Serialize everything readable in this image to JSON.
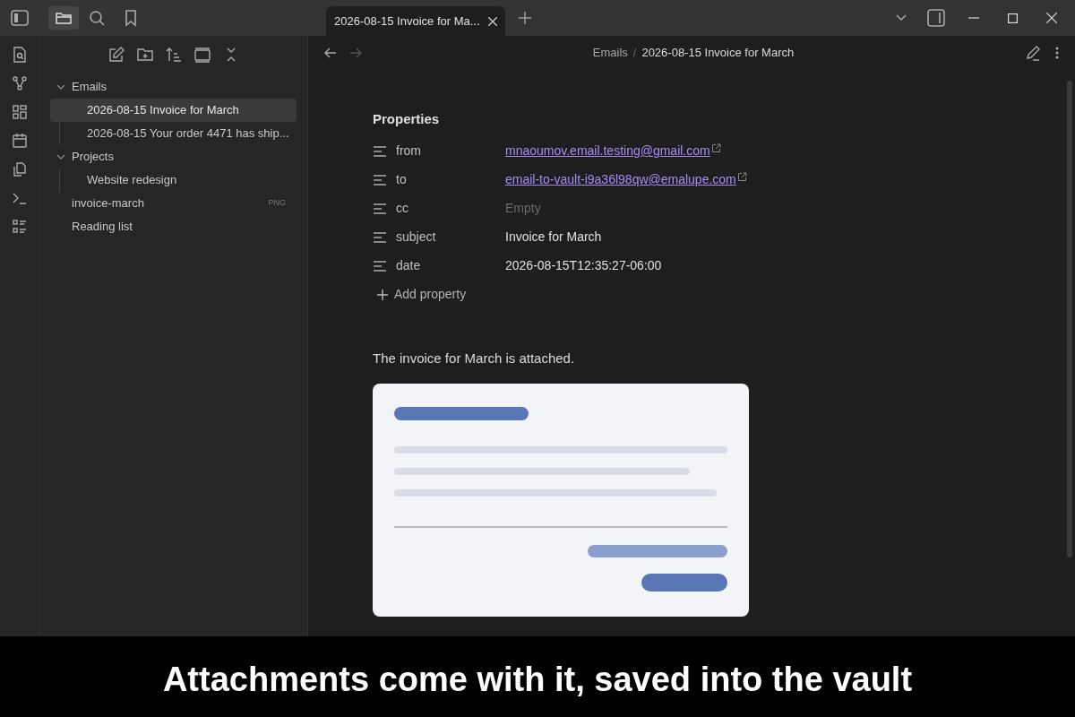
{
  "tabs": [
    {
      "label": "2026-08-15 Invoice for Ma...",
      "selected": true
    }
  ],
  "file_tree": [
    {
      "label": "Emails",
      "kind": "folder",
      "expanded": true,
      "selected": false,
      "children": [
        {
          "label": "2026-08-15 Invoice for March",
          "selected": true
        },
        {
          "label": "2026-08-15 Your order 4471 has ship...",
          "selected": false
        }
      ]
    },
    {
      "label": "Projects",
      "kind": "folder",
      "expanded": true,
      "selected": false,
      "children": [
        {
          "label": "Website redesign",
          "selected": false
        }
      ]
    },
    {
      "label": "invoice-march",
      "kind": "file",
      "badge": "PNG",
      "selected": false
    },
    {
      "label": "Reading list",
      "kind": "file",
      "selected": false
    }
  ],
  "breadcrumb": {
    "parent": "Emails",
    "separator": "/",
    "current": "2026-08-15 Invoice for March"
  },
  "properties": {
    "title": "Properties",
    "rows": [
      {
        "key": "from",
        "value": "mnaoumov.email.testing@gmail.com",
        "kind": "link"
      },
      {
        "key": "to",
        "value": "email-to-vault-i9a36l98qw@emalupe.com",
        "kind": "link"
      },
      {
        "key": "cc",
        "value": "Empty",
        "kind": "empty"
      },
      {
        "key": "subject",
        "value": "Invoice for March",
        "kind": "text"
      },
      {
        "key": "date",
        "value": "2026-08-15T12:35:27-06:00",
        "kind": "text"
      }
    ],
    "add_label": "Add property"
  },
  "body_text": "The invoice for March is attached.",
  "caption": "Attachments come with it, saved into the vault"
}
